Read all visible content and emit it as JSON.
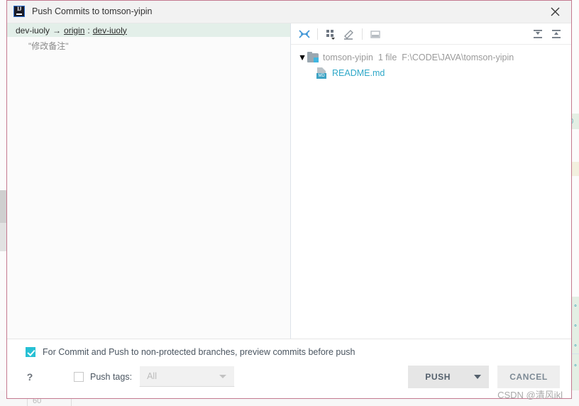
{
  "window": {
    "app_icon": "intellij-idea-icon",
    "title": "Push Commits to tomson-yipin",
    "close_icon": "close-icon"
  },
  "commits_panel": {
    "branch_row": {
      "local_branch": "dev-iuoly",
      "arrow": "→",
      "remote": "origin",
      "separator": ":",
      "remote_branch": "dev-iuoly"
    },
    "commit_message": "\"修改备注\""
  },
  "files_panel": {
    "toolbar": [
      {
        "name": "show-diff-icon",
        "label": "Show Diff"
      },
      {
        "name": "group-by-icon",
        "label": "Group By"
      },
      {
        "name": "edit-source-icon",
        "label": "Edit Source"
      },
      {
        "name": "preview-icon",
        "label": "Preview"
      },
      {
        "name": "expand-all-icon",
        "label": "Expand All"
      },
      {
        "name": "collapse-all-icon",
        "label": "Collapse All"
      }
    ],
    "tree": {
      "root": {
        "caret": "▼",
        "icon": "module-folder-icon",
        "name": "tomson-yipin",
        "count": "1 file",
        "path": "F:\\CODE\\JAVA\\tomson-yipin"
      },
      "children": [
        {
          "icon": "markdown-file-icon",
          "icon_label": "MD",
          "name": "README.md"
        }
      ]
    }
  },
  "options": {
    "preview_checkbox": {
      "checked": true,
      "label": "For Commit and Push to non-protected branches, preview commits before push"
    },
    "help_label": "?",
    "push_tags_checkbox": {
      "checked": false,
      "label": "Push tags:"
    },
    "tags_combo": {
      "value": "All",
      "placeholder": "All",
      "arrow_icon": "chevron-down-icon"
    }
  },
  "actions": {
    "push_label": "PUSH",
    "push_dropdown_icon": "chevron-down-icon",
    "cancel_label": "CANCEL"
  },
  "watermark": {
    "text": "CSDN @清风ikl"
  },
  "background": {
    "bottom_number": "60",
    "chips": [
      "©",
      "·°",
      "·°",
      "·°",
      "·°"
    ]
  },
  "colors": {
    "dialog_border": "#c4798f",
    "accent": "#27c0d4",
    "link": "#2fa8c8",
    "selection": "#e3efe9"
  }
}
